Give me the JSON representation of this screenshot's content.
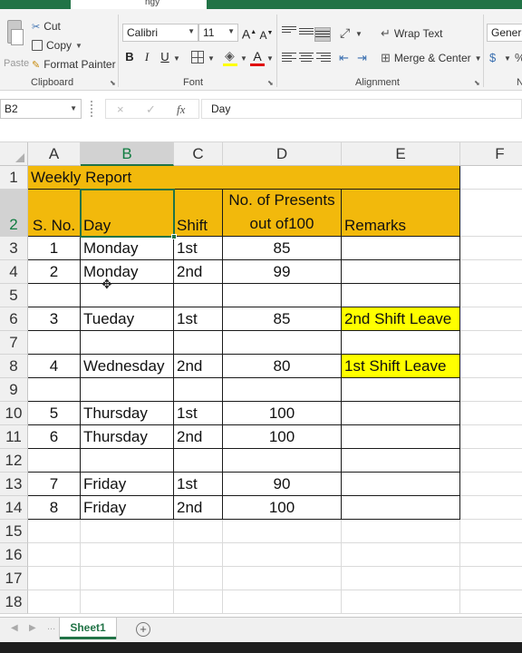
{
  "title_bar": {
    "text": "ngy"
  },
  "ribbon": {
    "clipboard": {
      "paste_label": "Paste",
      "cut_label": "Cut",
      "copy_label": "Copy",
      "format_painter_label": "Format Painter",
      "group_label": "Clipboard"
    },
    "font": {
      "font_name": "Calibri",
      "font_size": "11",
      "grow_label": "A",
      "shrink_label": "A",
      "bold_label": "B",
      "italic_label": "I",
      "underline_label": "U",
      "font_color_label": "A",
      "group_label": "Font"
    },
    "alignment": {
      "wrap_text_label": "Wrap Text",
      "merge_center_label": "Merge & Center",
      "group_label": "Alignment"
    },
    "number": {
      "format": "Genera",
      "group_label": "N"
    },
    "accent_color": "#217346"
  },
  "formula_bar": {
    "name_box": "B2",
    "cancel_icon": "×",
    "enter_icon": "✓",
    "fx_label": "fx",
    "content": "Day"
  },
  "columns": [
    "A",
    "B",
    "C",
    "D",
    "E",
    "F"
  ],
  "rows": [
    "1",
    "2",
    "3",
    "4",
    "5",
    "6",
    "7",
    "8",
    "9",
    "10",
    "11",
    "12",
    "13",
    "14",
    "15",
    "16",
    "17",
    "18"
  ],
  "sheet": {
    "title": "Weekly Report",
    "headers": {
      "sno": "S. No.",
      "day": "Day",
      "shift": "Shift",
      "presents": "No. of Presents out of100",
      "remarks": "Remarks"
    },
    "records": [
      {
        "sno": "1",
        "day": "Monday",
        "shift": "1st",
        "presents": "85",
        "remarks": ""
      },
      {
        "sno": "2",
        "day": "Monday",
        "shift": "2nd",
        "presents": "99",
        "remarks": ""
      },
      {
        "sno": "",
        "day": "",
        "shift": "",
        "presents": "",
        "remarks": ""
      },
      {
        "sno": "3",
        "day": "Tueday",
        "shift": "1st",
        "presents": "85",
        "remarks": "2nd Shift Leave"
      },
      {
        "sno": "",
        "day": "",
        "shift": "",
        "presents": "",
        "remarks": ""
      },
      {
        "sno": "4",
        "day": "Wednesday",
        "shift": "2nd",
        "presents": "80",
        "remarks": "1st Shift Leave"
      },
      {
        "sno": "",
        "day": "",
        "shift": "",
        "presents": "",
        "remarks": ""
      },
      {
        "sno": "5",
        "day": "Thursday",
        "shift": "1st",
        "presents": "100",
        "remarks": ""
      },
      {
        "sno": "6",
        "day": "Thursday",
        "shift": "2nd",
        "presents": "100",
        "remarks": ""
      },
      {
        "sno": "",
        "day": "",
        "shift": "",
        "presents": "",
        "remarks": ""
      },
      {
        "sno": "7",
        "day": "Friday",
        "shift": "1st",
        "presents": "90",
        "remarks": ""
      },
      {
        "sno": "8",
        "day": "Friday",
        "shift": "2nd",
        "presents": "100",
        "remarks": ""
      }
    ],
    "header_fill": "#f2b90c",
    "remark_fill": "#ffff00"
  },
  "tabs": {
    "sheet_name": "Sheet1",
    "add_label": "+",
    "prev_label": "◀",
    "next_label": "▶",
    "dots": "..."
  }
}
